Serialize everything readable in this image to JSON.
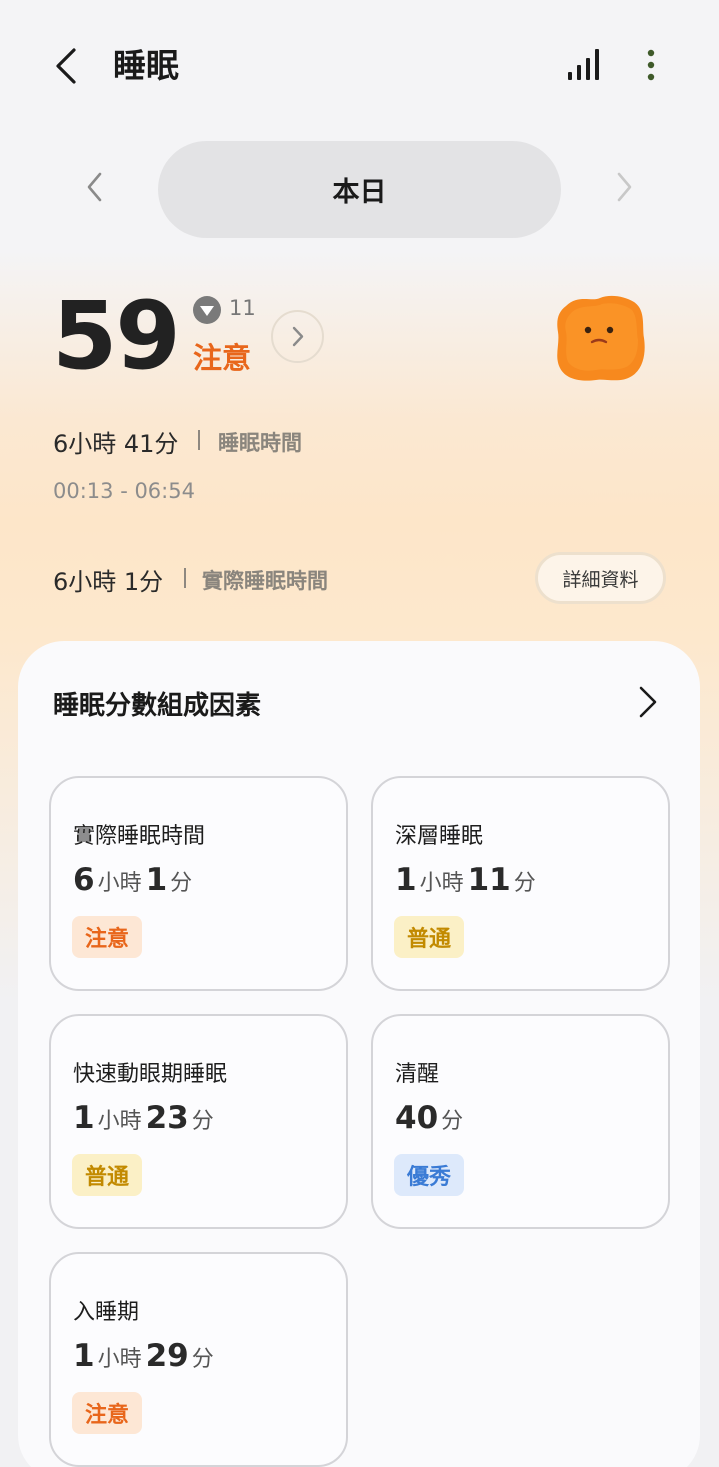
{
  "header": {
    "title": "睡眠",
    "icons": {
      "back": "chevron-left-icon",
      "chart": "signal-bars-icon",
      "more": "more-vertical-icon"
    }
  },
  "date_selector": {
    "label": "本日"
  },
  "score": {
    "value": "59",
    "delta": "11",
    "delta_direction": "down",
    "status": "注意",
    "status_color": "#e8661b"
  },
  "sleep_time": {
    "value": "6小時 41分",
    "label": "睡眠時間",
    "range": "00:13 - 06:54"
  },
  "actual_sleep": {
    "value": "6小時 1分",
    "label": "實際睡眠時間",
    "details_button": "詳細資料"
  },
  "factors": {
    "title": "睡眠分數組成因素",
    "items": [
      {
        "name": "實際睡眠時間",
        "h": "6",
        "h_unit": "小時",
        "m": "1",
        "m_unit": "分",
        "badge": "注意",
        "badge_type": "warn"
      },
      {
        "name": "深層睡眠",
        "h": "1",
        "h_unit": "小時",
        "m": "11",
        "m_unit": "分",
        "badge": "普通",
        "badge_type": "normal"
      },
      {
        "name": "快速動眼期睡眠",
        "h": "1",
        "h_unit": "小時",
        "m": "23",
        "m_unit": "分",
        "badge": "普通",
        "badge_type": "normal"
      },
      {
        "name": "清醒",
        "m": "40",
        "m_unit": "分",
        "badge": "優秀",
        "badge_type": "good"
      },
      {
        "name": "入睡期",
        "h": "1",
        "h_unit": "小時",
        "m": "29",
        "m_unit": "分",
        "badge": "注意",
        "badge_type": "warn"
      }
    ]
  },
  "colors": {
    "warn": "#e8661b",
    "normal": "#c28a00",
    "good": "#3a7bd5"
  }
}
